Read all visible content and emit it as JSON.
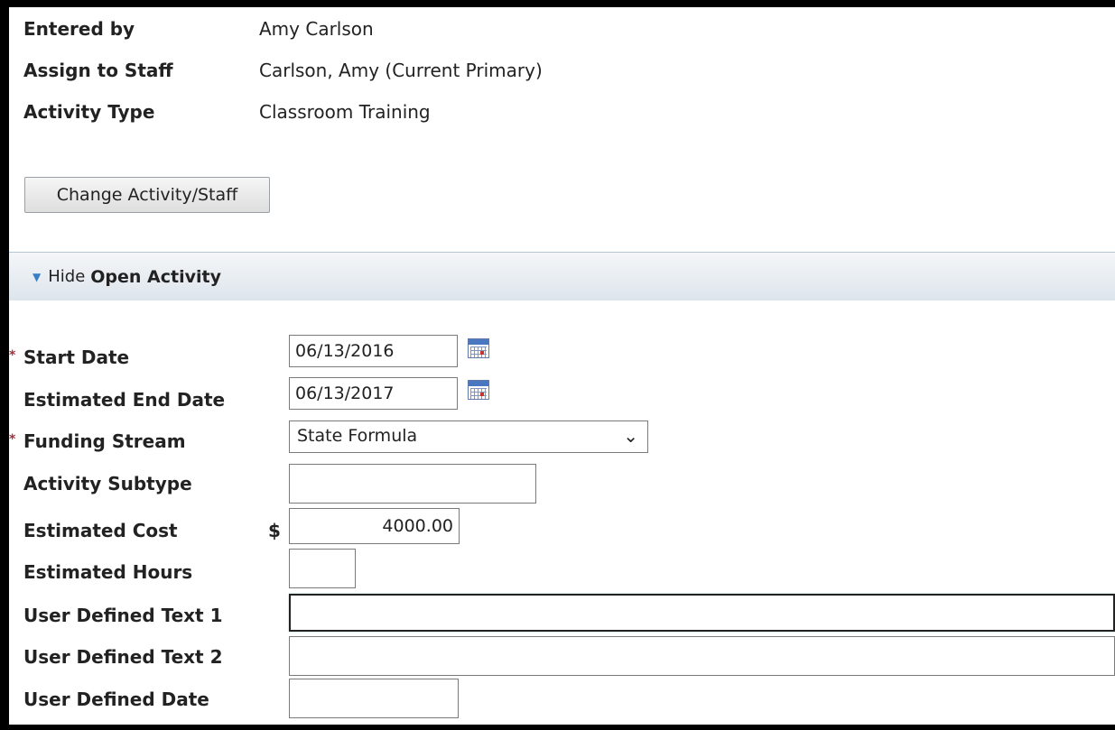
{
  "info": {
    "entered_by_label": "Entered by",
    "entered_by_value": "Amy Carlson",
    "assign_label": "Assign to Staff",
    "assign_value": "Carlson, Amy (Current Primary)",
    "activity_type_label": "Activity Type",
    "activity_type_value": "Classroom Training"
  },
  "change_button": "Change Activity/Staff",
  "section": {
    "hide_label": "Hide",
    "title": "Open Activity"
  },
  "form": {
    "start_date_label": "Start Date",
    "start_date_value": "06/13/2016",
    "end_date_label": "Estimated End Date",
    "end_date_value": "06/13/2017",
    "funding_label": "Funding Stream",
    "funding_value": "State Formula",
    "subtype_label": "Activity Subtype",
    "subtype_value": "",
    "cost_label": "Estimated Cost",
    "currency": "$",
    "cost_value": "4000.00",
    "hours_label": "Estimated Hours",
    "hours_value": "",
    "udt1_label": "User Defined Text 1",
    "udt1_value": "",
    "udt2_label": "User Defined Text 2",
    "udt2_value": "",
    "udd_label": "User Defined Date",
    "udd_value": ""
  },
  "required_marker": "*",
  "icons": {
    "calendar": "calendar-icon",
    "dropdown": "chevron-down-icon",
    "collapse": "triangle-down-icon"
  },
  "colors": {
    "section_bar": "#dde5ec",
    "required": "#a0303a",
    "accent": "#3a7ec6"
  }
}
